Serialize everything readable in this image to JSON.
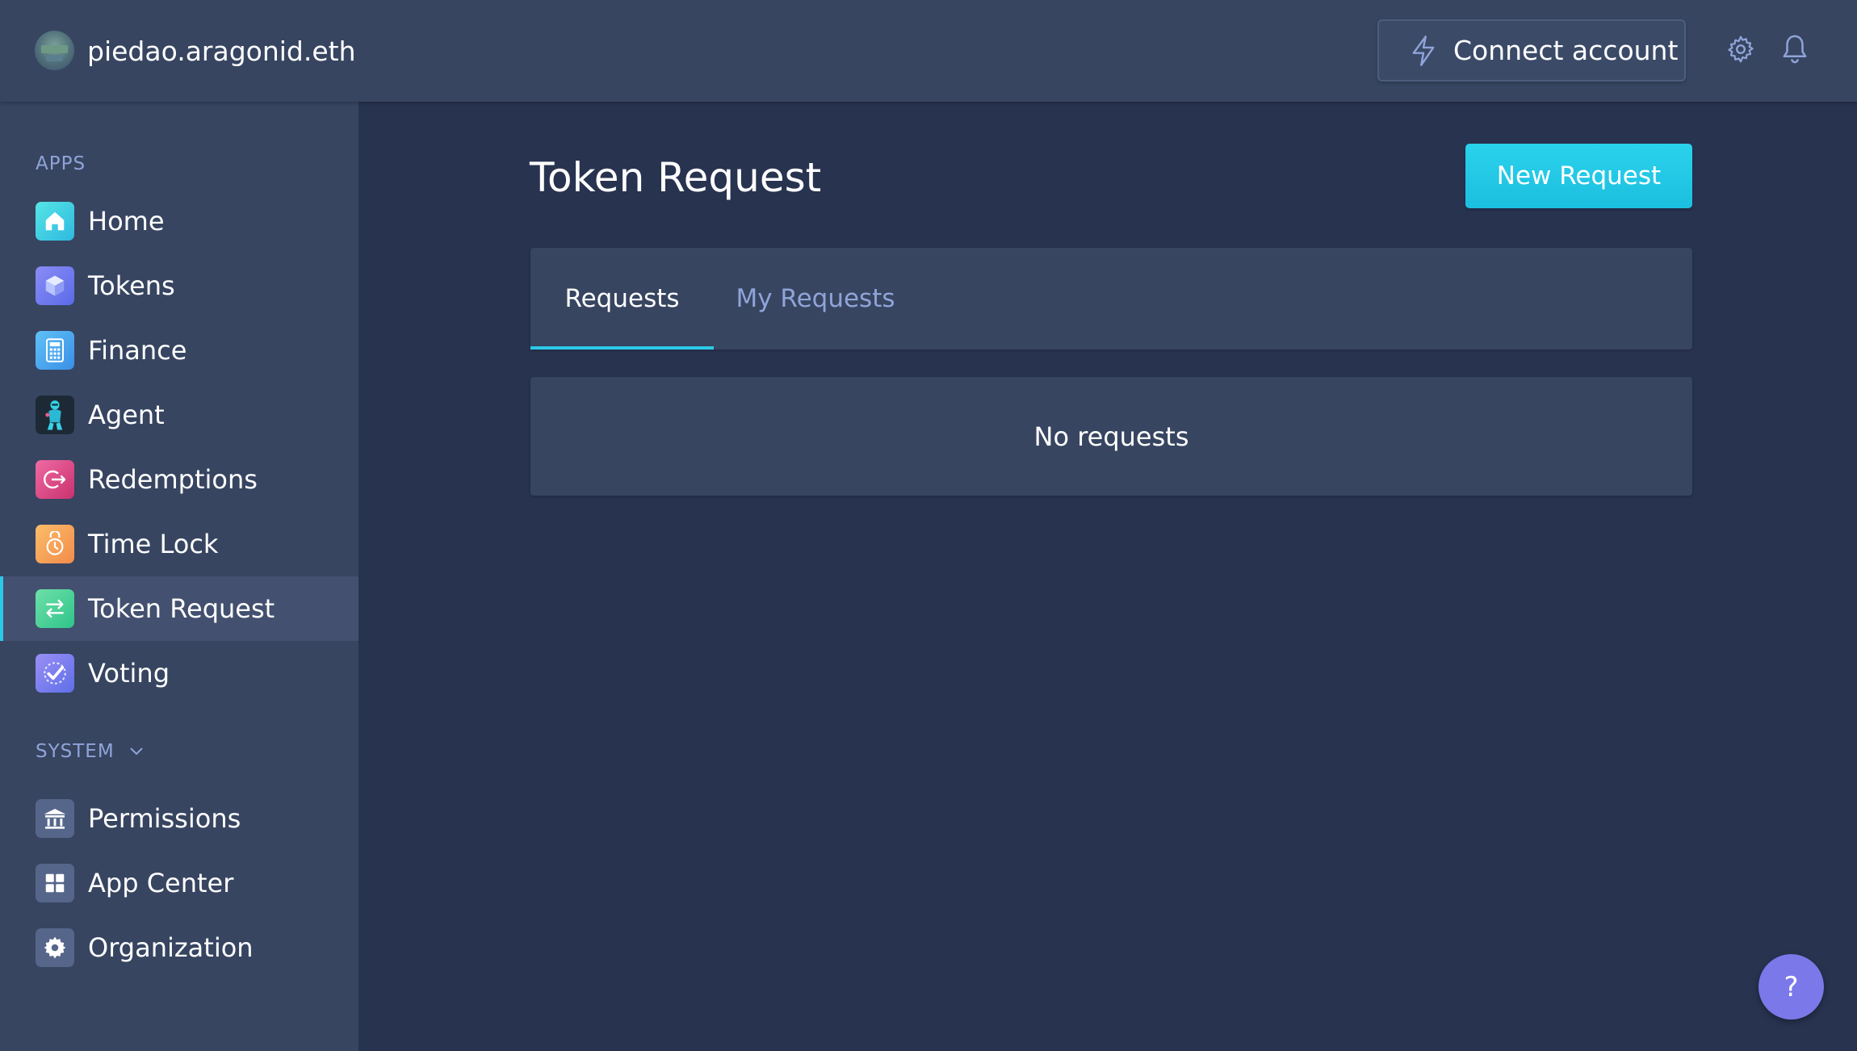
{
  "header": {
    "org_name": "piedao.aragonid.eth",
    "connect_label": "Connect account",
    "connect_icon": "lightning-icon",
    "settings_icon": "gear-icon",
    "notifications_icon": "bell-icon"
  },
  "sidebar": {
    "apps_label": "APPS",
    "system_label": "SYSTEM",
    "apps": [
      {
        "label": "Home",
        "icon": "home-icon",
        "color": "#3fd6e3"
      },
      {
        "label": "Tokens",
        "icon": "cube-icon",
        "color": "#7a80f2"
      },
      {
        "label": "Finance",
        "icon": "calculator-icon",
        "color": "#4aa7f0"
      },
      {
        "label": "Agent",
        "icon": "robot-icon",
        "color": "#1f2b38"
      },
      {
        "label": "Redemptions",
        "icon": "exit-icon",
        "color": "#e0528e"
      },
      {
        "label": "Time Lock",
        "icon": "timer-lock-icon",
        "color": "#f4a45a"
      },
      {
        "label": "Token Request",
        "icon": "swap-arrows-icon",
        "color": "#3fd69c"
      },
      {
        "label": "Voting",
        "icon": "checkmark-icon",
        "color": "#7a7ff2"
      }
    ],
    "system": [
      {
        "label": "Permissions",
        "icon": "institution-icon"
      },
      {
        "label": "App Center",
        "icon": "grid-icon"
      },
      {
        "label": "Organization",
        "icon": "cog-icon"
      }
    ],
    "active_item": "Token Request"
  },
  "main": {
    "title": "Token Request",
    "new_request_label": "New Request",
    "tabs": [
      {
        "label": "Requests",
        "active": true
      },
      {
        "label": "My Requests",
        "active": false
      }
    ],
    "empty_message": "No requests"
  },
  "help": {
    "label": "?"
  },
  "colors": {
    "background": "#283350",
    "surface": "#374561",
    "accent": "#2cc9e6",
    "muted_text": "#8fa4d8",
    "help_button": "#7b78e9"
  }
}
